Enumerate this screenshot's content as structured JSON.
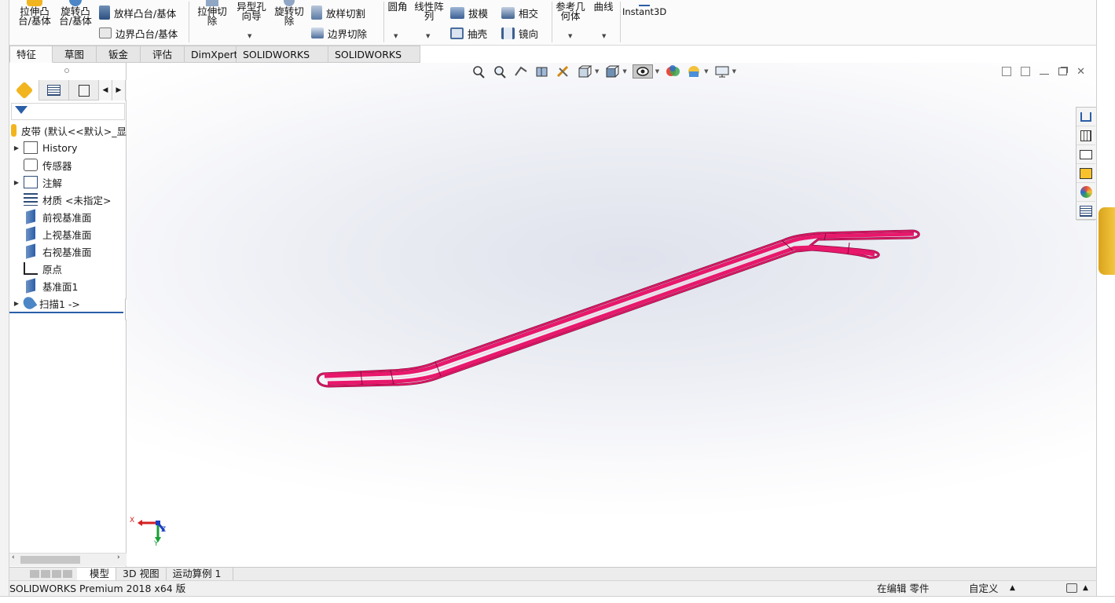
{
  "ribbon": {
    "extrude_boss": "拉伸凸\n台/基体",
    "revolve_boss": "旋转凸\n台/基体",
    "loft_boss": "放样凸台/基体",
    "boundary_boss": "边界凸台/基体",
    "extrude_cut": "拉伸切\n除",
    "hole_wizard": "异型孔\n向导",
    "revolve_cut": "旋转切\n除",
    "loft_cut": "放样切割",
    "boundary_cut": "边界切除",
    "fillet": "圆角",
    "linear_pattern": "线性阵\n列",
    "draft": "拔模",
    "intersect": "相交",
    "shell": "抽壳",
    "mirror": "镜向",
    "ref_geometry": "参考几\n何体",
    "curves": "曲线",
    "instant3d": "Instant3D"
  },
  "command_tabs": [
    "特征",
    "草图",
    "钣金",
    "评估",
    "DimXpert",
    "SOLIDWORKS 插件",
    "SOLIDWORKS MBD"
  ],
  "feature_tree": {
    "root": "皮带  (默认<<默认>_显",
    "items": [
      {
        "label": "History",
        "icon": "history-folder-icon",
        "expandable": true
      },
      {
        "label": "传感器",
        "icon": "sensor-icon",
        "expandable": false
      },
      {
        "label": "注解",
        "icon": "annotation-icon",
        "expandable": true
      },
      {
        "label": "材质 <未指定>",
        "icon": "material-icon",
        "expandable": false
      },
      {
        "label": "前视基准面",
        "icon": "plane-icon",
        "expandable": false
      },
      {
        "label": "上视基准面",
        "icon": "plane-icon",
        "expandable": false
      },
      {
        "label": "右视基准面",
        "icon": "plane-icon",
        "expandable": false
      },
      {
        "label": "原点",
        "icon": "origin-icon",
        "expandable": false
      },
      {
        "label": "基准面1",
        "icon": "plane-icon",
        "expandable": false
      },
      {
        "label": "扫描1 ->",
        "icon": "sweep-icon",
        "expandable": true
      }
    ]
  },
  "triad": {
    "x": "X",
    "y": "Y",
    "z": "Z"
  },
  "model_tabs": [
    "模型",
    "3D 视图",
    "运动算例 1"
  ],
  "status": {
    "product": "SOLIDWORKS Premium 2018 x64 版",
    "editing": "在编辑 零件",
    "units": "自定义"
  },
  "colors": {
    "part": "#e8186c",
    "part_edge": "#8a0a3c",
    "accent": "#2a5ea8"
  }
}
